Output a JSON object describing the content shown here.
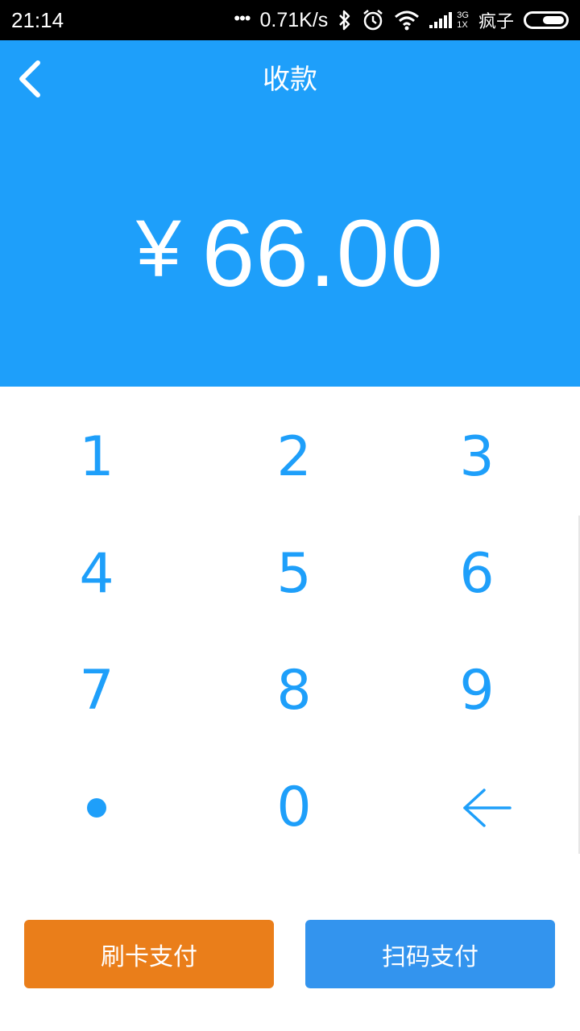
{
  "status_bar": {
    "time": "21:14",
    "dots": "•••",
    "speed": "0.71K/s",
    "network_top": "3G",
    "network_bottom": "1X",
    "carrier": "疯子",
    "icons": [
      "bluetooth-icon",
      "alarm-icon",
      "wifi-icon",
      "signal-icon",
      "battery-icon"
    ]
  },
  "header": {
    "title": "收款",
    "back_icon": "chevron-left-icon",
    "currency_symbol": "¥",
    "amount": "66.00"
  },
  "keypad": {
    "keys": [
      "1",
      "2",
      "3",
      "4",
      "5",
      "6",
      "7",
      "8",
      "9",
      "•",
      "0",
      "←"
    ],
    "dot_key_icon": "dot-icon",
    "backspace_icon": "backspace-arrow-icon"
  },
  "buttons": {
    "card_pay": "刷卡支付",
    "scan_pay": "扫码支付"
  },
  "colors": {
    "primary_blue": "#1e9ffa",
    "card_button": "#ea7e1a",
    "scan_button": "#3394ee",
    "status_bar": "#000000"
  }
}
